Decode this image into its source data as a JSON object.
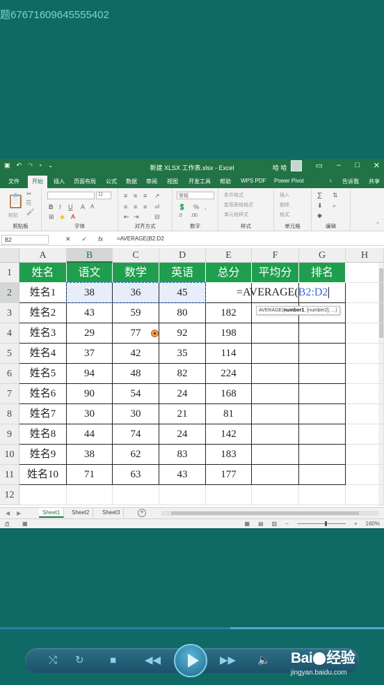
{
  "watermark": {
    "text": "题676716096455554​02"
  },
  "titlebar": {
    "document_title": "新建 XLSX 工作表.xlsx - Excel",
    "user_name": "哈 哈",
    "icons": [
      "save-icon",
      "undo-icon",
      "redo-icon",
      "customize-icon",
      "ribbon-display-icon",
      "minimize-icon",
      "maximize-icon",
      "close-icon"
    ]
  },
  "tabs": [
    {
      "label": "文件"
    },
    {
      "label": "开始"
    },
    {
      "label": "插入"
    },
    {
      "label": "页面布局"
    },
    {
      "label": "公式"
    },
    {
      "label": "数据"
    },
    {
      "label": "审阅"
    },
    {
      "label": "视图"
    },
    {
      "label": "开发工具"
    },
    {
      "label": "帮助"
    },
    {
      "label": "WPS PDF"
    },
    {
      "label": "Power Pivot"
    }
  ],
  "tab_right": {
    "tell_me": "告诉我",
    "share": "共享"
  },
  "ribbon": {
    "paste_label": "粘贴",
    "font_size": "11",
    "number_format": "常规",
    "groups": {
      "clipboard": "剪贴板",
      "font": "字体",
      "alignment": "对齐方式",
      "number": "数字",
      "styles": "样式",
      "cells": "单元格",
      "editing": "编辑"
    },
    "styles_items": [
      "条件格式",
      "套用表格格式",
      "单元格样式"
    ],
    "cells_items": [
      "插入",
      "删除",
      "格式"
    ]
  },
  "formula_bar": {
    "name_box": "B2",
    "formula": "=AVERAGE(B2:D2"
  },
  "grid": {
    "columns": [
      "A",
      "B",
      "C",
      "D",
      "E",
      "F",
      "G",
      "H"
    ],
    "rows": [
      "1",
      "2",
      "3",
      "4",
      "5",
      "6",
      "7",
      "8",
      "9",
      "10",
      "11",
      "12"
    ],
    "header": [
      "姓名",
      "语文",
      "数学",
      "英语",
      "总分",
      "平均分",
      "排名"
    ],
    "data": [
      [
        "姓名1",
        "38",
        "36",
        "45",
        "",
        "",
        ""
      ],
      [
        "姓名2",
        "43",
        "59",
        "80",
        "182",
        "",
        ""
      ],
      [
        "姓名3",
        "29",
        "77",
        "92",
        "198",
        "",
        ""
      ],
      [
        "姓名4",
        "37",
        "42",
        "35",
        "114",
        "",
        ""
      ],
      [
        "姓名5",
        "94",
        "48",
        "82",
        "224",
        "",
        ""
      ],
      [
        "姓名6",
        "90",
        "54",
        "24",
        "168",
        "",
        ""
      ],
      [
        "姓名7",
        "30",
        "30",
        "21",
        "81",
        "",
        ""
      ],
      [
        "姓名8",
        "44",
        "74",
        "24",
        "142",
        "",
        ""
      ],
      [
        "姓名9",
        "38",
        "62",
        "83",
        "183",
        "",
        ""
      ],
      [
        "姓名10",
        "71",
        "63",
        "43",
        "177",
        "",
        ""
      ]
    ],
    "editing_formula_prefix": "=AVERAGE(",
    "editing_formula_ref": "B2:D2",
    "tooltip_fn": "AVERAGE(",
    "tooltip_arg1": "number1",
    "tooltip_rest": ", [number2], ...)"
  },
  "sheets": [
    {
      "label": "Sheet1",
      "active": true
    },
    {
      "label": "Sheet2",
      "active": false
    },
    {
      "label": "Sheet3",
      "active": false
    }
  ],
  "statusbar": {
    "mode": "点",
    "zoom": "160%"
  },
  "player": {
    "progress_fraction": 0.6,
    "brand": "Bai",
    "brand_tail": "经验",
    "site": "jingyan.baidu.com"
  },
  "colors": {
    "excel_green": "#217346",
    "header_green": "#1f9e4e",
    "background_teal": "#0f6a66",
    "ref_blue": "#3b6bd1"
  }
}
